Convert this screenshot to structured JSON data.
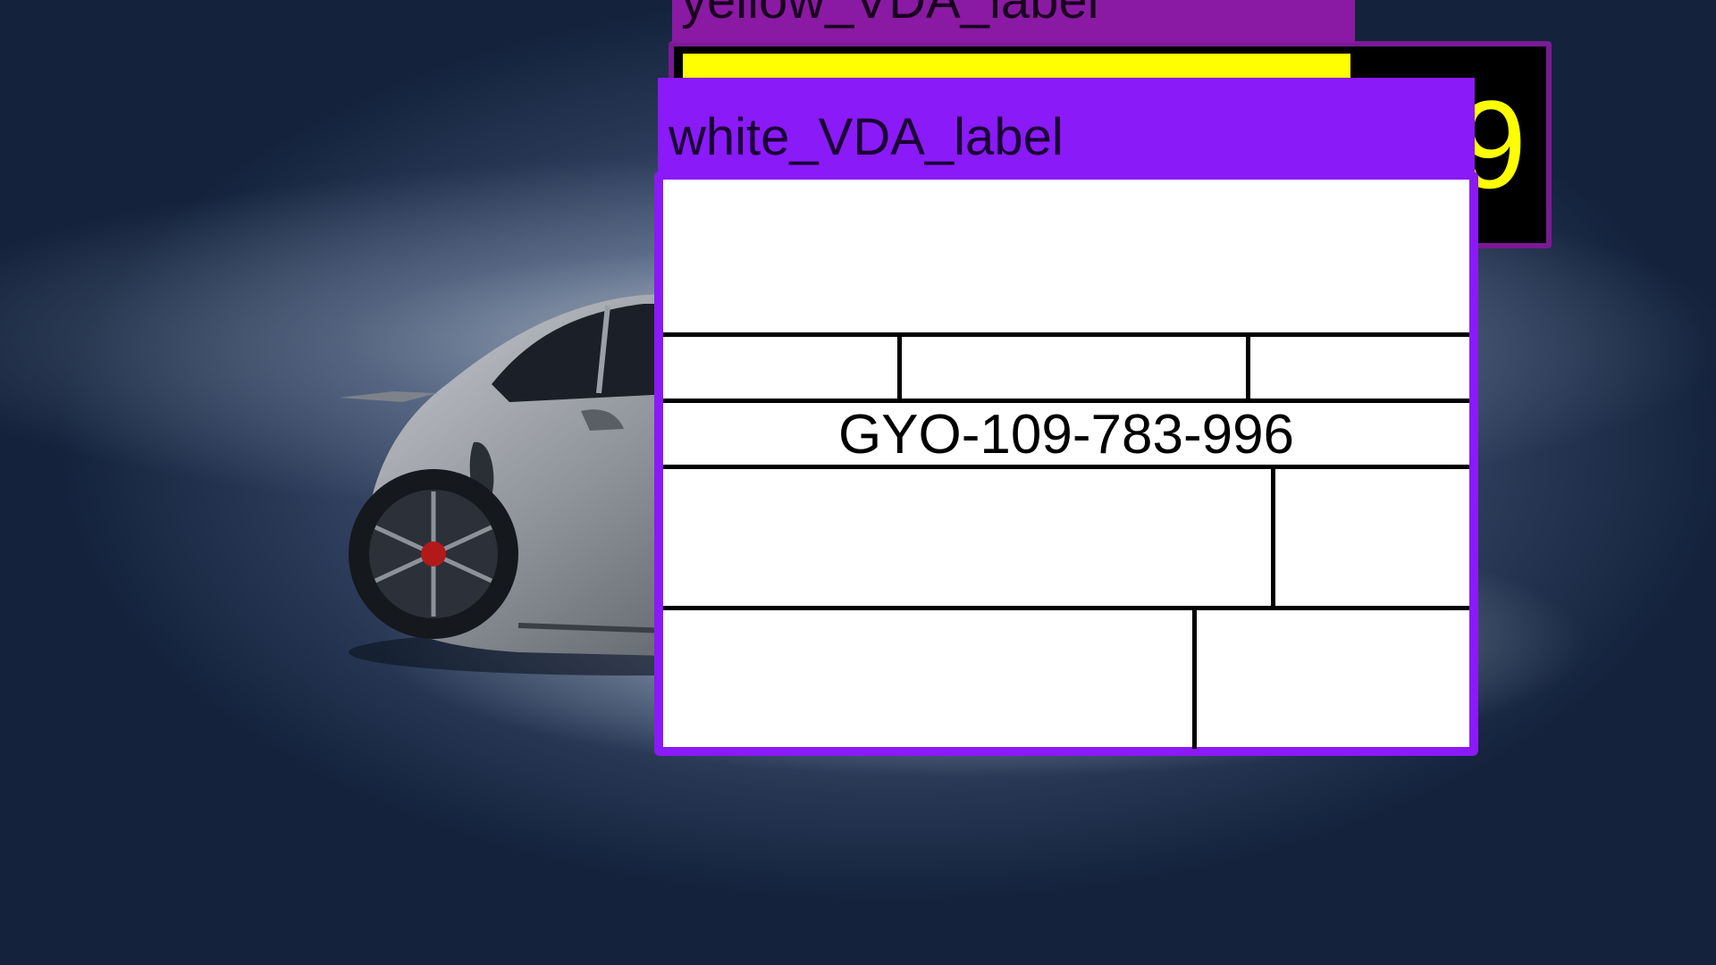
{
  "labels": {
    "yellow": {
      "title": "yellow_VDA_label",
      "number": "9",
      "colors": {
        "frame": "#7a1a95",
        "bar": "#ffff00",
        "background": "#000000"
      }
    },
    "white": {
      "title": "white_VDA_label",
      "part_number": "GYO-109-783-996",
      "colors": {
        "header": "#8a1af7",
        "card": "#ffffff"
      }
    }
  },
  "background": {
    "subject": "car-photo"
  }
}
